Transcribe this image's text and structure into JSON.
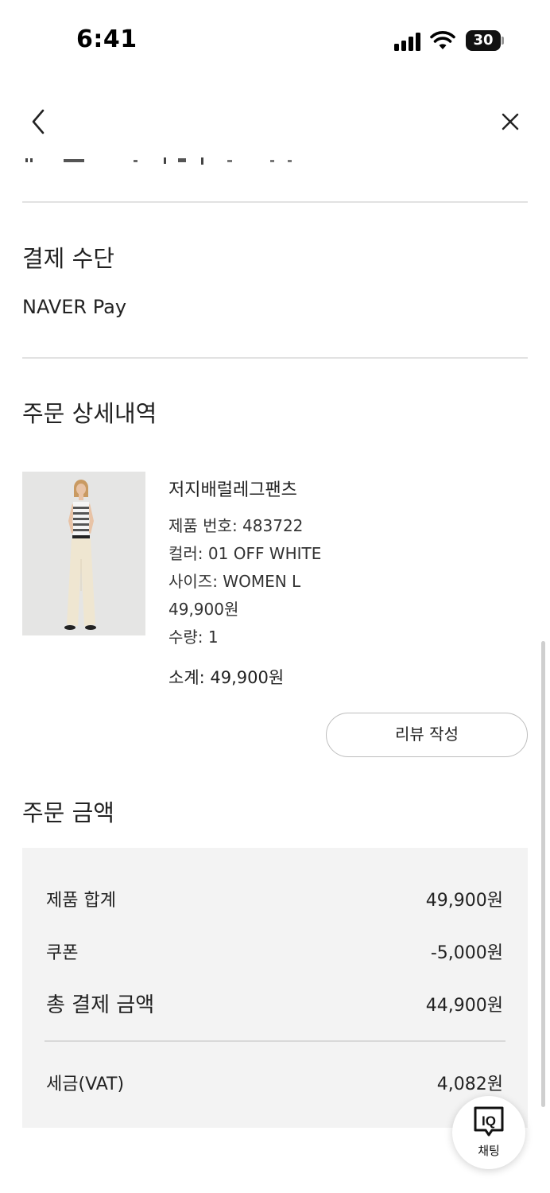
{
  "status_bar": {
    "time": "6:41",
    "battery": "30"
  },
  "sections": {
    "payment_title": "결제 수단",
    "payment_method": "NAVER Pay",
    "order_detail_title": "주문 상세내역",
    "order_amount_title": "주문 금액"
  },
  "product": {
    "name": "저지배럴레그팬츠",
    "number": "제품 번호: 483722",
    "color": "컬러: 01 OFF WHITE",
    "size": "사이즈: WOMEN L",
    "price": "49,900원",
    "quantity": "수량: 1",
    "subtotal": "소계: 49,900원",
    "review_button": "리뷰 작성"
  },
  "summary": {
    "rows": [
      {
        "label": "제품 합계",
        "value": "49,900원"
      },
      {
        "label": "쿠폰",
        "value": "-5,000원"
      },
      {
        "label": "총 결제 금액",
        "value": "44,900원"
      },
      {
        "label": "세금(VAT)",
        "value": "4,082원"
      }
    ]
  },
  "chat": {
    "logo": "IQ",
    "label": "채팅"
  }
}
